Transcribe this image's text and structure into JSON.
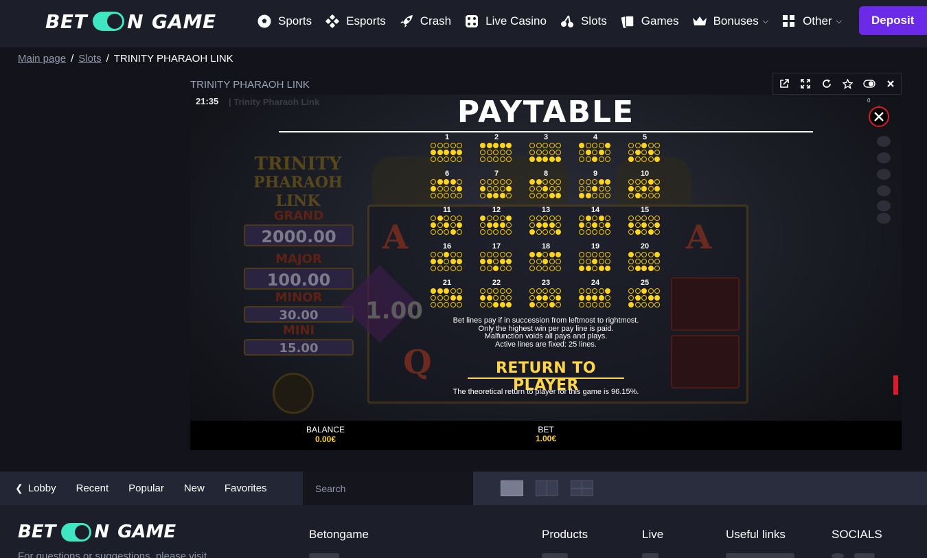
{
  "header": {
    "logo": {
      "w1": "BET",
      "w2": "N",
      "w3": "GAME"
    },
    "nav": [
      {
        "label": "Sports",
        "icon": "soccer-ball-icon"
      },
      {
        "label": "Esports",
        "icon": "gamepad-icon"
      },
      {
        "label": "Crash",
        "icon": "rocket-icon"
      },
      {
        "label": "Live Casino",
        "icon": "dice-icon"
      },
      {
        "label": "Slots",
        "icon": "cherries-icon"
      },
      {
        "label": "Games",
        "icon": "cards-icon"
      },
      {
        "label": "Bonuses",
        "icon": "crown-icon",
        "dropdown": true
      },
      {
        "label": "Other",
        "icon": "grid-icon",
        "dropdown": true
      }
    ],
    "deposit_label": "Deposit",
    "accent": "#6a2ae8",
    "logo_accent": "#3ee6c1"
  },
  "breadcrumb": {
    "main": "Main page",
    "slots": "Slots",
    "current": "TRINITY PHARAOH LINK",
    "sep": "/"
  },
  "game": {
    "title": "TRINITY PHARAOH LINK",
    "tools": [
      "external-link-icon",
      "fullscreen-icon",
      "reload-icon",
      "star-icon",
      "toggle-icon",
      "close-icon"
    ],
    "clock": "21:35",
    "tab_title": "| Trinity Pharaoh Link",
    "sound_count": "0",
    "background": {
      "logo_line1": "TRINITY",
      "logo_line2": "PHARAOH LINK",
      "jackpots": [
        {
          "label": "GRAND",
          "value": "2000.00"
        },
        {
          "label": "MAJOR",
          "value": "100.00"
        },
        {
          "label": "MINOR",
          "value": "30.00"
        },
        {
          "label": "MINI",
          "value": "15.00"
        }
      ],
      "gem_value": "1.00",
      "letter_a": "A",
      "letter_q": "Q"
    },
    "paytable": {
      "title": "PAYTABLE",
      "lines": [
        {
          "n": "1",
          "rows": [
            0,
            0,
            0,
            0,
            0,
            1,
            1,
            1,
            1,
            1,
            0,
            0,
            0,
            0,
            0
          ]
        },
        {
          "n": "2",
          "rows": [
            1,
            1,
            1,
            1,
            1,
            0,
            0,
            0,
            0,
            0,
            0,
            0,
            0,
            0,
            0
          ]
        },
        {
          "n": "3",
          "rows": [
            0,
            0,
            0,
            0,
            0,
            0,
            0,
            0,
            0,
            0,
            1,
            1,
            1,
            1,
            1
          ]
        },
        {
          "n": "4",
          "rows": [
            1,
            0,
            0,
            0,
            1,
            0,
            1,
            0,
            1,
            0,
            0,
            0,
            1,
            0,
            0
          ]
        },
        {
          "n": "5",
          "rows": [
            0,
            0,
            1,
            0,
            0,
            0,
            1,
            0,
            1,
            0,
            1,
            0,
            0,
            0,
            1
          ]
        },
        {
          "n": "6",
          "rows": [
            0,
            1,
            1,
            1,
            0,
            1,
            0,
            0,
            0,
            1,
            0,
            0,
            0,
            0,
            0
          ]
        },
        {
          "n": "7",
          "rows": [
            0,
            0,
            0,
            0,
            0,
            1,
            0,
            0,
            0,
            1,
            0,
            1,
            1,
            1,
            0
          ]
        },
        {
          "n": "8",
          "rows": [
            1,
            1,
            0,
            0,
            0,
            0,
            0,
            1,
            0,
            0,
            0,
            0,
            0,
            1,
            1
          ]
        },
        {
          "n": "9",
          "rows": [
            0,
            0,
            0,
            1,
            1,
            0,
            0,
            1,
            0,
            0,
            1,
            1,
            0,
            0,
            0
          ]
        },
        {
          "n": "10",
          "rows": [
            0,
            0,
            0,
            1,
            0,
            1,
            0,
            1,
            0,
            1,
            0,
            1,
            0,
            0,
            0
          ]
        },
        {
          "n": "11",
          "rows": [
            0,
            1,
            0,
            0,
            0,
            1,
            0,
            1,
            0,
            1,
            0,
            0,
            0,
            1,
            0
          ]
        },
        {
          "n": "12",
          "rows": [
            1,
            0,
            0,
            0,
            1,
            0,
            1,
            1,
            1,
            0,
            0,
            0,
            0,
            0,
            0
          ]
        },
        {
          "n": "13",
          "rows": [
            0,
            0,
            0,
            0,
            0,
            0,
            1,
            1,
            1,
            0,
            1,
            0,
            0,
            0,
            1
          ]
        },
        {
          "n": "14",
          "rows": [
            0,
            1,
            0,
            1,
            0,
            1,
            0,
            1,
            0,
            1,
            0,
            0,
            0,
            0,
            0
          ]
        },
        {
          "n": "15",
          "rows": [
            0,
            0,
            0,
            0,
            0,
            1,
            0,
            1,
            0,
            1,
            0,
            1,
            0,
            1,
            0
          ]
        },
        {
          "n": "16",
          "rows": [
            0,
            0,
            1,
            0,
            0,
            1,
            1,
            0,
            1,
            1,
            0,
            0,
            0,
            0,
            0
          ]
        },
        {
          "n": "17",
          "rows": [
            0,
            0,
            0,
            0,
            0,
            1,
            1,
            0,
            1,
            1,
            0,
            0,
            1,
            0,
            0
          ]
        },
        {
          "n": "18",
          "rows": [
            1,
            1,
            0,
            1,
            1,
            0,
            0,
            1,
            0,
            0,
            0,
            0,
            0,
            0,
            0
          ]
        },
        {
          "n": "19",
          "rows": [
            0,
            0,
            0,
            0,
            0,
            0,
            0,
            1,
            0,
            0,
            1,
            1,
            0,
            1,
            1
          ]
        },
        {
          "n": "20",
          "rows": [
            1,
            0,
            0,
            0,
            1,
            0,
            0,
            0,
            0,
            0,
            0,
            1,
            1,
            1,
            0
          ]
        },
        {
          "n": "21",
          "rows": [
            1,
            1,
            1,
            0,
            0,
            0,
            0,
            0,
            1,
            1,
            0,
            0,
            0,
            0,
            0
          ]
        },
        {
          "n": "22",
          "rows": [
            0,
            0,
            0,
            0,
            0,
            1,
            1,
            0,
            0,
            0,
            0,
            0,
            1,
            1,
            1
          ]
        },
        {
          "n": "23",
          "rows": [
            0,
            0,
            0,
            0,
            0,
            0,
            1,
            1,
            0,
            1,
            1,
            0,
            0,
            1,
            0
          ]
        },
        {
          "n": "24",
          "rows": [
            0,
            0,
            0,
            0,
            1,
            1,
            1,
            1,
            1,
            0,
            0,
            0,
            0,
            0,
            0
          ]
        },
        {
          "n": "25",
          "rows": [
            0,
            0,
            1,
            0,
            0,
            0,
            1,
            0,
            1,
            1,
            1,
            0,
            0,
            0,
            0
          ]
        }
      ],
      "rules": [
        "Bet lines pay if in succession from leftmost to rightmost.",
        "Only the highest win per pay line is paid.",
        "Malfunction voids all pays and plays.",
        "Active lines are fixed: 25 lines."
      ],
      "rtp_title": "RETURN TO PLAYER",
      "rtp_text": "The theoretical return to player for this game is 96.15%."
    },
    "balance_label": "BALANCE",
    "balance_value": "0.00€",
    "bet_label": "BET",
    "bet_value": "1.00€",
    "dot_color": "#ffd41c"
  },
  "lobby": {
    "tabs": [
      {
        "label": "Lobby",
        "icon": "chevron-left-icon"
      },
      {
        "label": "Recent"
      },
      {
        "label": "Popular"
      },
      {
        "label": "New"
      },
      {
        "label": "Favorites"
      }
    ],
    "search_placeholder": "Search",
    "views": [
      "view-large-icon",
      "view-medium-icon",
      "view-small-icon"
    ]
  },
  "footer": {
    "logo": {
      "w1": "BET",
      "w2": "N",
      "w3": "GAME"
    },
    "columns": [
      "Betongame",
      "Products",
      "Live",
      "Useful links",
      "SOCIALS"
    ],
    "contact_text": "For questions or suggestions, please visit"
  }
}
